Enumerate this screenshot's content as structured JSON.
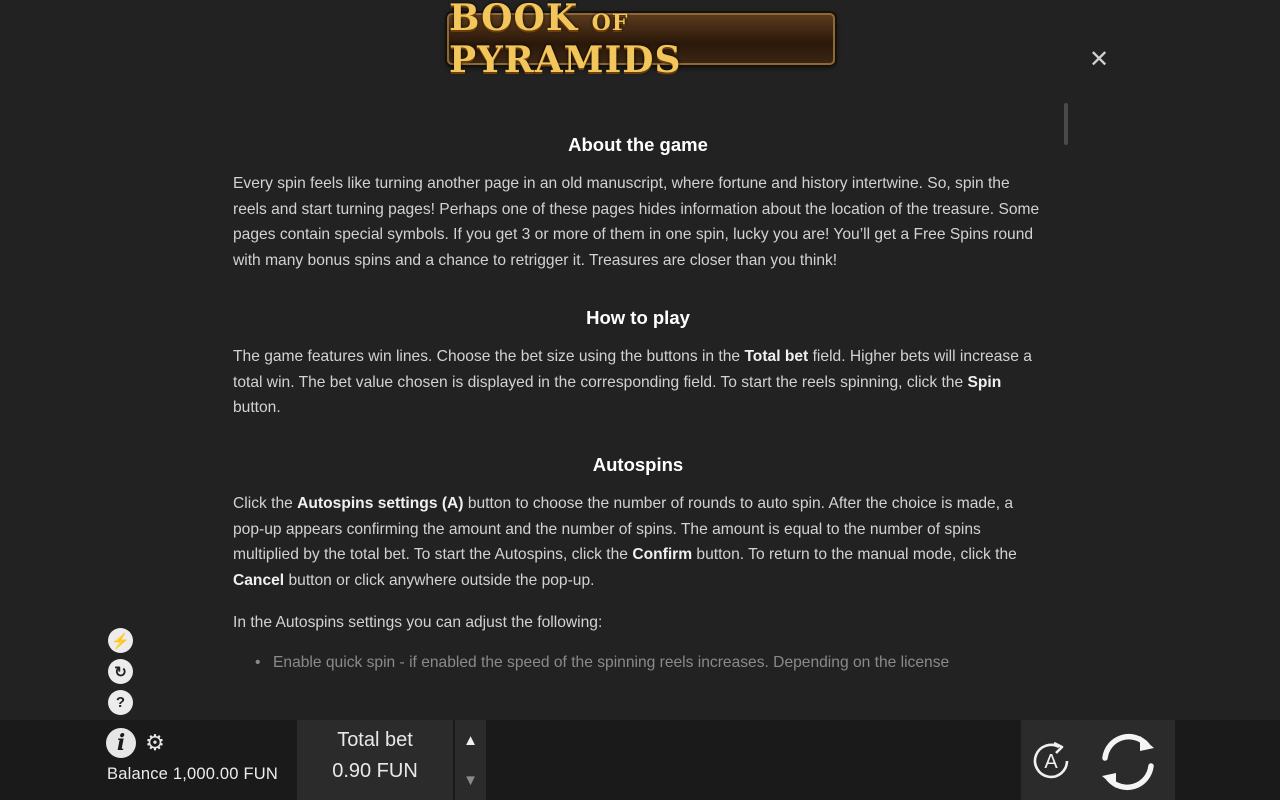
{
  "logo": {
    "part1": "BOOK",
    "part2": "OF",
    "part3": "PYRAMIDS"
  },
  "close": {
    "symbol": "✕"
  },
  "sections": {
    "about": {
      "title": "About the game",
      "text": "Every spin feels like turning another page in an old manuscript, where fortune and history intertwine. So, spin the reels and start turning pages! Perhaps one of these pages hides information about the location of the treasure. Some pages contain special symbols. If you get 3 or more of them in one spin, lucky you are! You’ll get a Free Spins round with many bonus spins and a chance to retrigger it. Treasures are closer than you think!"
    },
    "howto": {
      "title": "How to play",
      "t1": "The game features win lines. Choose the bet size using the buttons in the ",
      "b1": "Total bet",
      "t2": " field. Higher bets will increase a total win. The bet value chosen is displayed in the corresponding field. To start the reels spinning, click the ",
      "b2": "Spin",
      "t3": " button."
    },
    "autospins": {
      "title": "Autospins",
      "t1": "Click the ",
      "b1": "Autospins settings (A)",
      "t2": " button to choose the number of rounds to auto spin. After the choice is made, a pop-up appears confirming the amount and the number of spins. The amount is equal to the number of spins multiplied by the total bet. To start the Autospins, click the ",
      "b2": "Confirm",
      "t3": " button. To return to the manual mode, click the ",
      "b3": "Cancel",
      "t4": " button or click anywhere outside the pop-up.",
      "p2": "In the Autospins settings you can adjust the following:",
      "item1": "Enable quick spin - if enabled the speed of the spinning reels increases. Depending on the license"
    }
  },
  "side_icons": [
    {
      "name": "turbo-icon",
      "glyph": "⚡"
    },
    {
      "name": "autoplay-stats-icon",
      "glyph": "↻"
    },
    {
      "name": "help-icon",
      "glyph": "?"
    }
  ],
  "bottom": {
    "info_glyph": "i",
    "gear_glyph": "⚙",
    "balance_label": "Balance",
    "balance_value": "1,000.00 FUN",
    "bet_label": "Total bet",
    "bet_value": "0.90 FUN",
    "up_glyph": "▲",
    "down_glyph": "▼",
    "auto_letter": "A"
  },
  "colors": {
    "background": "#222222",
    "bar": "#1a1a1a",
    "panel": "#2b2b2b",
    "logo_gold": "#f2c65a"
  }
}
